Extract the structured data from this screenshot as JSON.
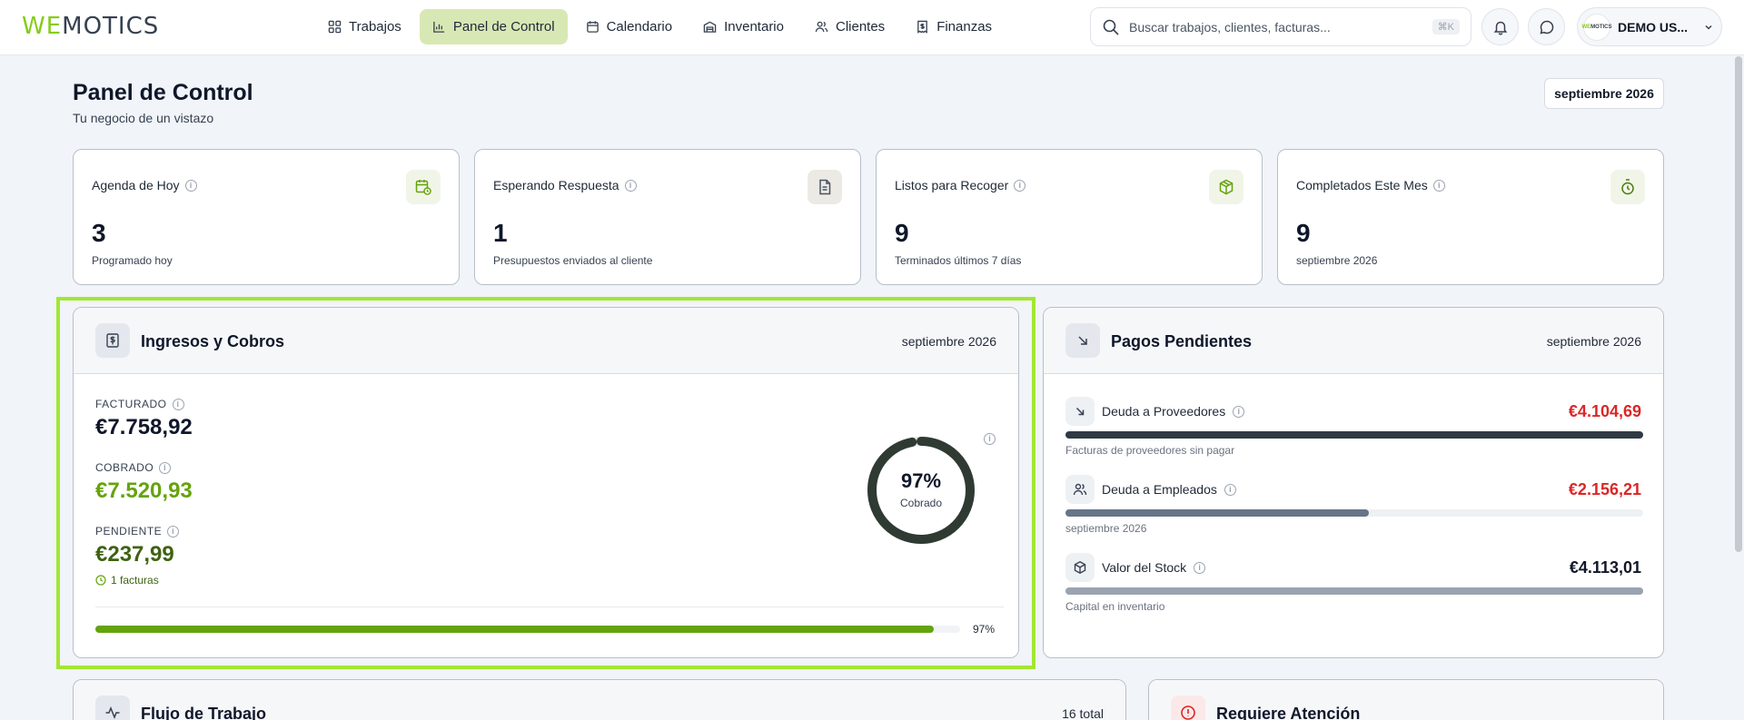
{
  "brand": {
    "logo_we": "WE",
    "logo_rest": "MOTICS"
  },
  "nav": [
    {
      "label": "Trabajos",
      "icon": "grid-icon",
      "active": false
    },
    {
      "label": "Panel de Control",
      "icon": "bar-chart-icon",
      "active": true
    },
    {
      "label": "Calendario",
      "icon": "calendar-icon",
      "active": false
    },
    {
      "label": "Inventario",
      "icon": "warehouse-icon",
      "active": false
    },
    {
      "label": "Clientes",
      "icon": "users-icon",
      "active": false
    },
    {
      "label": "Finanzas",
      "icon": "receipt-icon",
      "active": false
    }
  ],
  "search": {
    "placeholder": "Buscar trabajos, clientes, facturas...",
    "shortcut": "⌘K"
  },
  "user": {
    "name": "DEMO US..."
  },
  "header": {
    "title": "Panel de Control",
    "subtitle": "Tu negocio de un vistazo",
    "month": "septiembre 2026"
  },
  "stats": [
    {
      "label": "Agenda de Hoy",
      "value": "3",
      "note": "Programado hoy",
      "icon": "calendar-clock-icon",
      "icon_color": "#65a30d",
      "icon_bg": "#f1f5e8"
    },
    {
      "label": "Esperando Respuesta",
      "value": "1",
      "note": "Presupuestos enviados al cliente",
      "icon": "document-icon",
      "icon_color": "#4b5563",
      "icon_bg": "#eceae4"
    },
    {
      "label": "Listos para Recoger",
      "value": "9",
      "note": "Terminados últimos 7 días",
      "icon": "package-icon",
      "icon_color": "#65a30d",
      "icon_bg": "#f1f5e8"
    },
    {
      "label": "Completados Este Mes",
      "value": "9",
      "note": "septiembre 2026",
      "icon": "timer-icon",
      "icon_color": "#4d7c0f",
      "icon_bg": "#f1f5e8"
    }
  ],
  "income": {
    "title": "Ingresos y Cobros",
    "month": "septiembre 2026",
    "invoiced_label": "FACTURADO",
    "invoiced_value": "€7.758,92",
    "collected_label": "COBRADO",
    "collected_value": "€7.520,93",
    "pending_label": "PENDIENTE",
    "pending_value": "€237,99",
    "pending_invoices": "1 facturas",
    "donut_pct_text": "97%",
    "donut_label": "Cobrado",
    "collected_fraction": 0.97,
    "bar_pct_text": "97%",
    "colors": {
      "invoiced": "#0f172a",
      "collected": "#65a30d",
      "pending": "#3f6212",
      "donut": "#2f3a33"
    }
  },
  "payments": {
    "title": "Pagos Pendientes",
    "month": "septiembre 2026",
    "rows": [
      {
        "label": "Deuda a Proveedores",
        "amount": "€4.104,69",
        "note": "Facturas de proveedores sin pagar",
        "fraction": 1.0,
        "icon": "arrow-down-right-icon",
        "amount_color": "#dc2626",
        "bar_color": "#2f3a45"
      },
      {
        "label": "Deuda a Empleados",
        "amount": "€2.156,21",
        "note": "septiembre 2026",
        "fraction": 0.525,
        "icon": "users-icon",
        "amount_color": "#dc2626",
        "bar_color": "#667588"
      },
      {
        "label": "Valor del Stock",
        "amount": "€4.113,01",
        "note": "Capital en inventario",
        "fraction": 1.0,
        "icon": "cube-icon",
        "amount_color": "#0f172a",
        "bar_color": "#9aa3b0"
      }
    ]
  },
  "workflow": {
    "title": "Flujo de Trabajo",
    "total": "16 total"
  },
  "attention": {
    "title": "Requiere Atención"
  }
}
